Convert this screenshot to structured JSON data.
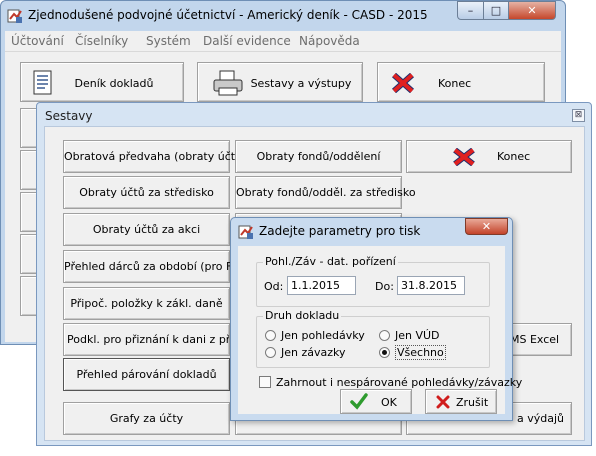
{
  "main_window": {
    "title": "Zjednodušené podvojné účetnictví - Americký deník - CASD - 2015",
    "controls": {
      "minimize": "–",
      "maximize": "□",
      "close": "✕"
    },
    "menu": [
      "Účtování",
      "Číselníky",
      "Systém",
      "Další evidence",
      "Nápověda"
    ],
    "buttons": {
      "journal": "Deník dokladů",
      "reports": "Sestavy a výstupy",
      "exit": "Konec"
    }
  },
  "reports_window": {
    "title": "Sestavy",
    "close": "⊠",
    "buttons": {
      "trial_balance": "Obratová předvaha (obraty účtů)",
      "account_turnover_center": "Obraty účtů za středisko",
      "account_turnover_action": "Obraty účtů za akci",
      "donors_overview": "Přehled dárců za období (pro FÚ)",
      "deductible_items": "Připoč. položky k zákl. daně",
      "tax_return_docs": "Podkl. pro přiznání k dani z příjmů",
      "pairing_overview": "Přehled párování dokladů",
      "account_charts": "Grafy za účty",
      "fund_turnover": "Obraty fondů/oddělení",
      "fund_turnover_center": "Obraty fondů/odděl. za středisko",
      "exit": "Konec",
      "ms_excel": "MS Excel",
      "expenses": "a výdajů"
    }
  },
  "dialog": {
    "title": "Zadejte parametry pro tisk",
    "close": "✕",
    "date_group_label": "Pohl./Záv - dat. pořízení",
    "from_label": "Od:",
    "from_value": "1.1.2015",
    "to_label": "Do:",
    "to_value": "31.8.2015",
    "doc_type_label": "Druh dokladu",
    "radios": {
      "receivables": "Jen pohledávky",
      "internal": "Jen VÚD",
      "payables": "Jen závazky",
      "all": "Všechno"
    },
    "selected_radio": "Všechno",
    "include_unpaired": "Zahrnout i nespárované pohledávky/závazky",
    "ok_label": "OK",
    "cancel_label": "Zrušit"
  },
  "colors": {
    "title_bar": "#c2d6ec",
    "face": "#f0f0f0",
    "close_red": "#c5472b",
    "ok_green": "#2e9b2e"
  }
}
